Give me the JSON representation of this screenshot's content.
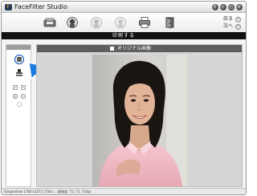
{
  "app": {
    "title": "FaceFilter Studio",
    "logo_glyph": "F"
  },
  "window_controls": [
    {
      "name": "help-icon",
      "glyph": "?"
    },
    {
      "name": "minimize-icon",
      "glyph": "–"
    },
    {
      "name": "maximize-icon",
      "glyph": "□"
    },
    {
      "name": "close-icon",
      "glyph": "×"
    }
  ],
  "toolbar": {
    "tools": [
      {
        "name": "scanner-icon"
      },
      {
        "name": "face-filter-icon"
      },
      {
        "name": "face-effect-icon"
      },
      {
        "name": "face-icon"
      },
      {
        "name": "print-icon"
      },
      {
        "name": "exit-door-icon"
      }
    ],
    "back_label": "戻る",
    "back_glyph": "‹",
    "next_label": "次へ",
    "next_glyph": "›"
  },
  "strip": {
    "label": "印刷する"
  },
  "sidebar": {
    "items": [
      {
        "name": "select-tool-icon"
      },
      {
        "name": "stamp-tool-icon"
      },
      {
        "name": "rotate-left-icon"
      },
      {
        "name": "rotate-right-icon"
      },
      {
        "name": "zoom-in-icon"
      },
      {
        "name": "zoom-out-icon"
      },
      {
        "name": "fit-icon"
      }
    ]
  },
  "panel": {
    "title": "オリジナル画像"
  },
  "status": {
    "text": "SimpleView   1764×2272 (756×...  解像度: 72, 72, 72dpi"
  },
  "colors": {
    "pointer_arrow": "#1a7be0",
    "black_strip": "#111111",
    "panel_header": "#5e5e5e",
    "panel_bg": "#d6d6d6"
  }
}
